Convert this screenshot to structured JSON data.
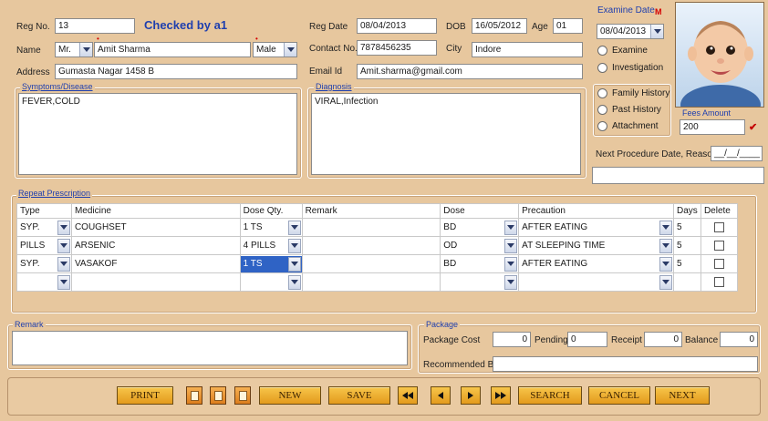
{
  "header": {
    "reg_no_label": "Reg No.",
    "reg_no": "13",
    "checked_by": "Checked by a1",
    "name_label": "Name",
    "title": "Mr.",
    "name": "Amit Sharma",
    "gender": "Male",
    "address_label": "Address",
    "address": "Gumasta Nagar 1458 B",
    "reg_date_label": "Reg Date",
    "reg_date": "08/04/2013",
    "dob_label": "DOB",
    "dob": "16/05/2012",
    "age_label": "Age",
    "age": "01",
    "contact_label": "Contact No.",
    "contact": "7878456235",
    "city_label": "City",
    "city": "Indore",
    "email_label": "Email Id",
    "email": "Amit.sharma@gmail.com"
  },
  "examine": {
    "label": "Examine Date",
    "required_mark": "M",
    "date": "08/04/2013",
    "options": [
      "Examine",
      "Investigation"
    ],
    "history_options": [
      "Family History",
      "Past History",
      "Attachment"
    ],
    "fees_label": "Fees Amount",
    "fees": "200"
  },
  "symptoms": {
    "title": "Symptoms/Disease",
    "text": "FEVER,COLD"
  },
  "diagnosis": {
    "title": "Diagnosis",
    "text": "VIRAL,Infection"
  },
  "next_procedure": {
    "label": "Next Procedure Date, Reason",
    "date": "__/__/____"
  },
  "prescription": {
    "title": "Repeat Prescription",
    "columns": [
      "Type",
      "Medicine",
      "Dose Qty.",
      "Remark",
      "Dose",
      "Precaution",
      "Days",
      "Delete"
    ],
    "rows": [
      {
        "type": "SYP.",
        "medicine": "COUGHSET",
        "qty": "1 TS",
        "remark": "",
        "dose": "BD",
        "precaution": "AFTER EATING",
        "days": "5"
      },
      {
        "type": "PILLS",
        "medicine": "ARSENIC",
        "qty": "4 PILLS",
        "remark": "",
        "dose": "OD",
        "precaution": "AT SLEEPING TIME",
        "days": "5"
      },
      {
        "type": "SYP.",
        "medicine": "VASAKOF",
        "qty": "1 TS",
        "remark": "",
        "dose": "BD",
        "precaution": "AFTER EATING",
        "days": "5"
      },
      {
        "type": "",
        "medicine": "",
        "qty": "",
        "remark": "",
        "dose": "",
        "precaution": "",
        "days": ""
      }
    ]
  },
  "remark": {
    "title": "Remark",
    "text": ""
  },
  "package": {
    "title": "Package",
    "cost_label": "Package Cost",
    "cost": "0",
    "pending_label": "Pending",
    "pending": "0",
    "receipt_label": "Receipt",
    "receipt": "0",
    "balance_label": "Balance",
    "balance": "0",
    "recommended_label": "Recommended By",
    "recommended": ""
  },
  "toolbar": {
    "print": "PRINT",
    "new": "NEW",
    "save": "SAVE",
    "search": "SEARCH",
    "cancel": "CANCEL",
    "next": "NEXT"
  },
  "colors": {
    "background": "#e7c79e",
    "title_blue": "#1f3fae",
    "button": "#f0b233",
    "selection": "#2f63c5"
  }
}
